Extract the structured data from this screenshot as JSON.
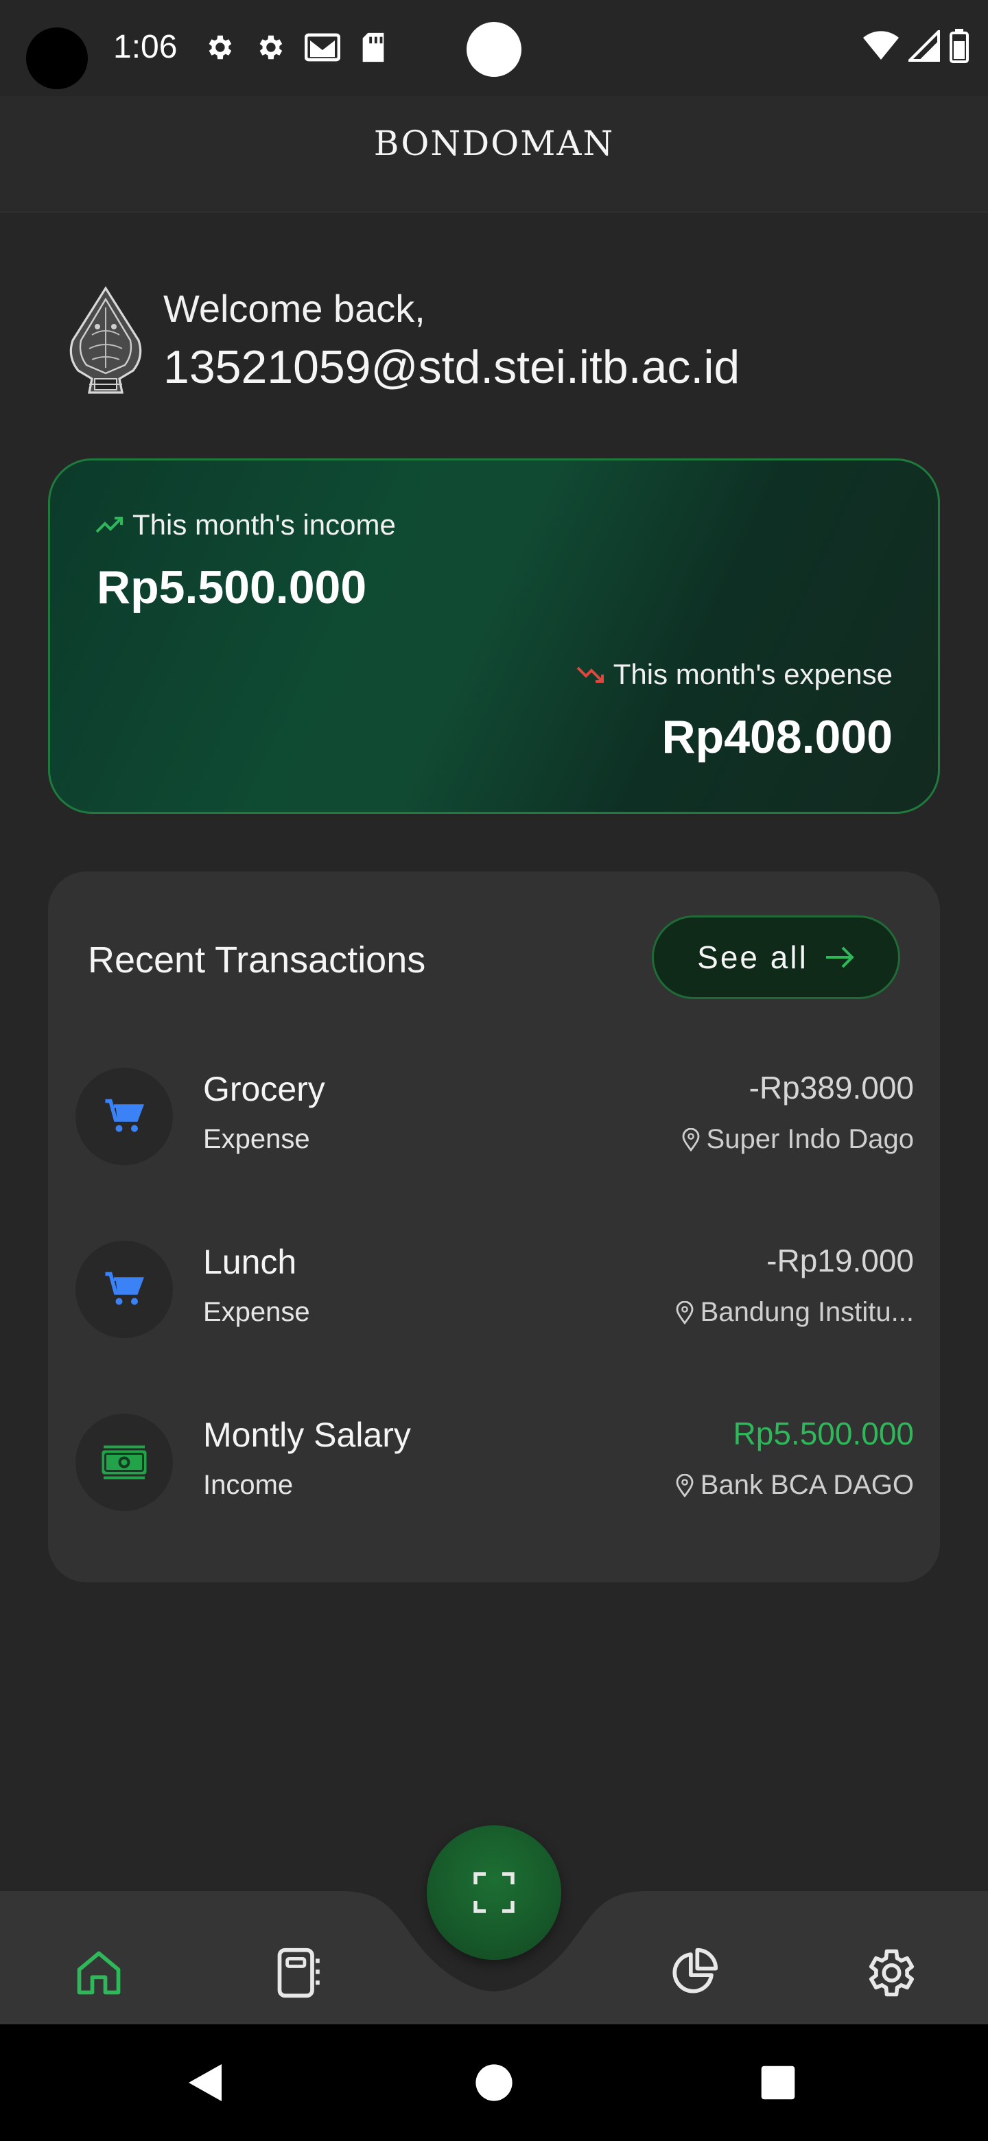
{
  "status_bar": {
    "time": "1:06",
    "icons_left": [
      "gear-icon",
      "gear-icon",
      "gmail-icon",
      "sd-card-icon"
    ],
    "icons_right": [
      "wifi-icon",
      "signal-icon",
      "battery-icon"
    ]
  },
  "header": {
    "title": "BONDOMAN"
  },
  "welcome": {
    "greeting": "Welcome back,",
    "user": "13521059@std.stei.itb.ac.id"
  },
  "summary": {
    "income_label": "This month's income",
    "income_value": "Rp5.500.000",
    "expense_label": "This month's expense",
    "expense_value": "Rp408.000"
  },
  "recent": {
    "title": "Recent Transactions",
    "see_all": "See all",
    "transactions": [
      {
        "name": "Grocery",
        "type": "Expense",
        "amount": "-Rp389.000",
        "location": "Super Indo Dago",
        "icon": "cart-icon"
      },
      {
        "name": "Lunch",
        "type": "Expense",
        "amount": "-Rp19.000",
        "location": "Bandung Institu...",
        "icon": "cart-icon"
      },
      {
        "name": "Montly Salary",
        "type": "Income",
        "amount": "Rp5.500.000",
        "location": "Bank BCA DAGO",
        "icon": "cash-icon"
      }
    ]
  },
  "bottom_nav": {
    "items": [
      "home-icon",
      "notebook-icon",
      "scan-icon",
      "pie-chart-icon",
      "settings-icon"
    ],
    "active": "home-icon"
  },
  "colors": {
    "accent_green": "#2fb85a",
    "expense_red": "#e0463c",
    "cart_blue": "#3b82f6",
    "background": "#262626",
    "card": "#323232"
  }
}
